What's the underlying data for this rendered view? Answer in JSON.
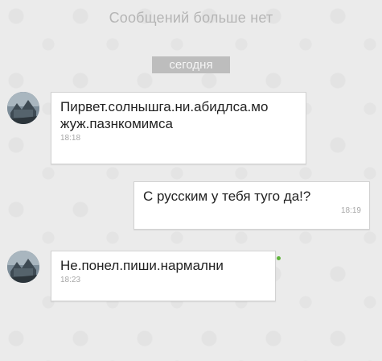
{
  "header": {
    "no_more_messages": "Сообщений больше нет"
  },
  "date_separator": "сегодня",
  "messages": [
    {
      "direction": "incoming",
      "text": "Пирвет.солнышга.ни.абидлса.мо жуж.пазнкомимса",
      "time": "18:18",
      "avatar_icon": "user-photo-avatar"
    },
    {
      "direction": "outgoing",
      "text": "С русским у тебя туго да!?",
      "time": "18:19"
    },
    {
      "direction": "incoming",
      "text": "Не.понел.пиши.нармални",
      "time": "18:23",
      "avatar_icon": "user-photo-avatar",
      "online_indicator": true
    }
  ],
  "colors": {
    "background": "#ebebeb",
    "bubble": "#ffffff",
    "date_chip": "#bdbdbd",
    "online": "#5fb43a"
  }
}
